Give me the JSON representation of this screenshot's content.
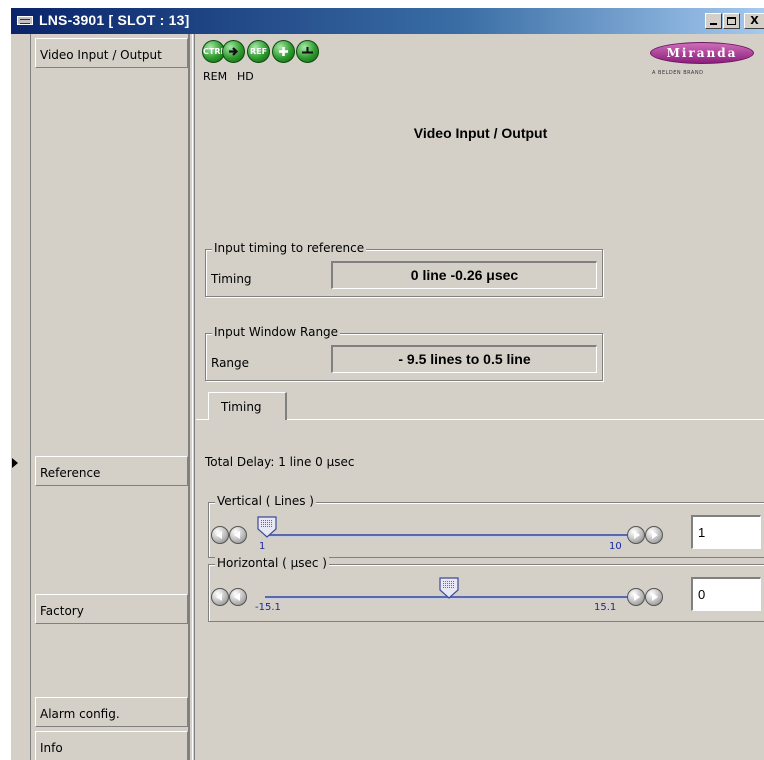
{
  "window": {
    "title": "LNS-3901  [ SLOT : 13]",
    "controls": {
      "minimize": "_",
      "maximize": "□",
      "close": "X"
    }
  },
  "sidebar": {
    "items": [
      {
        "label": "Video Input / Output"
      },
      {
        "label": "Reference"
      },
      {
        "label": "Factory"
      },
      {
        "label": "Alarm config."
      },
      {
        "label": "Info"
      }
    ]
  },
  "toolbar": {
    "icons": [
      {
        "name": "ctrl-status-icon",
        "text": "CTRL",
        "color": "#2e9a2e"
      },
      {
        "name": "arrow-status-icon",
        "text": "",
        "color": "#2e9a2e"
      },
      {
        "name": "ref-status-icon",
        "text": "REF",
        "color": "#2e9a2e"
      },
      {
        "name": "plus-status-icon",
        "text": "",
        "color": "#2e9a2e"
      },
      {
        "name": "bypass-status-icon",
        "text": "",
        "color": "#2e9a2e"
      }
    ],
    "labels": {
      "rem": "REM",
      "hd": "HD"
    }
  },
  "logo": {
    "name": "Miranda",
    "tagline": "A BELDEN BRAND",
    "color": "#8b1f7c"
  },
  "main": {
    "title": "Video Input / Output",
    "input_timing": {
      "legend": "Input timing to reference",
      "label": "Timing",
      "value": "0 line -0.26 μsec"
    },
    "input_window": {
      "legend": "Input Window Range",
      "label": "Range",
      "value": "- 9.5 lines to  0.5 line"
    },
    "tabs": [
      {
        "label": "Timing",
        "selected": true
      }
    ],
    "total_delay": "Total Delay:  1 line   0 μsec",
    "vertical": {
      "legend": "Vertical ( Lines )",
      "min": "1",
      "max": "10",
      "value": "1",
      "level": 0.0
    },
    "horizontal": {
      "legend": "Horizontal ( μsec )",
      "min": "-15.1",
      "max": "15.1",
      "value": "0",
      "level": 0.5
    }
  }
}
